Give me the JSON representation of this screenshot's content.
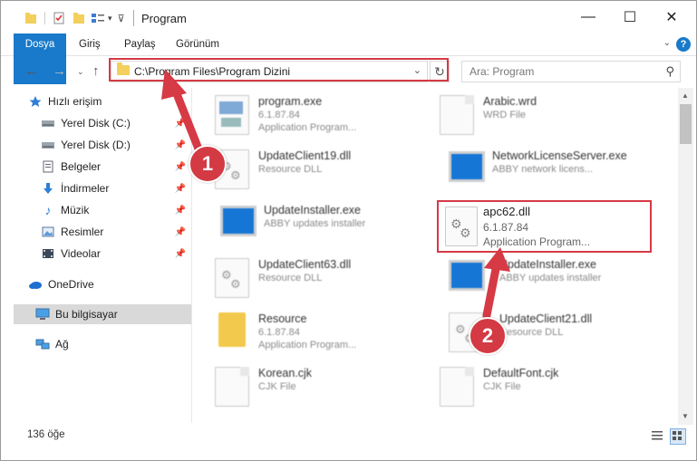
{
  "window": {
    "title": "Program",
    "minimize": "—",
    "maximize": "☐",
    "close": "✕"
  },
  "ribbon": {
    "tabs": [
      "Dosya",
      "Giriş",
      "Paylaş",
      "Görünüm"
    ],
    "help": "?"
  },
  "address": {
    "path": "C:\\Program Files\\Program Dizini"
  },
  "search": {
    "placeholder": "Ara: Program"
  },
  "sidebar": {
    "items": [
      {
        "label": "Hızlı erişim",
        "icon": "star-icon"
      },
      {
        "label": "Yerel Disk (C:)",
        "icon": "drive-icon",
        "pinned": true
      },
      {
        "label": "Yerel Disk (D:)",
        "icon": "drive-icon",
        "pinned": true
      },
      {
        "label": "Belgeler",
        "icon": "documents-icon",
        "pinned": true
      },
      {
        "label": "İndirmeler",
        "icon": "download-icon",
        "pinned": true
      },
      {
        "label": "Müzik",
        "icon": "music-icon",
        "pinned": true
      },
      {
        "label": "Resimler",
        "icon": "pictures-icon",
        "pinned": true
      },
      {
        "label": "Videolar",
        "icon": "videos-icon",
        "pinned": true
      },
      {
        "label": "OneDrive",
        "icon": "cloud-icon"
      },
      {
        "label": "Bu bilgisayar",
        "icon": "computer-icon",
        "selected": true
      },
      {
        "label": "Ağ",
        "icon": "network-icon"
      }
    ]
  },
  "files": [
    {
      "name": "program.exe",
      "line1": "6.1.87.84",
      "line2": "Application Program...",
      "kind": "exe"
    },
    {
      "name": "Arabic.wrd",
      "line1": "WRD File",
      "line2": "",
      "kind": "doc"
    },
    {
      "name": "UpdateClient19.dll",
      "line1": "Resource DLL",
      "line2": "",
      "kind": "dll"
    },
    {
      "name": "NetworkLicenseServer.exe",
      "line1": "ABBY network licens...",
      "line2": "",
      "kind": "win"
    },
    {
      "name": "UpdateInstaller.exe",
      "line1": "ABBY updates installer",
      "line2": "",
      "kind": "win"
    },
    {
      "name": "UpdateClient63.dll",
      "line1": "Resource DLL",
      "line2": "",
      "kind": "dll"
    },
    {
      "name": "UpdateInstaller.exe",
      "line1": "ABBY updates installer",
      "line2": "",
      "kind": "win"
    },
    {
      "name": "Resource",
      "line1": "6.1.87.84",
      "line2": "Application Program...",
      "kind": "folder"
    },
    {
      "name": "UpdateClient21.dll",
      "line1": "Resource DLL",
      "line2": "",
      "kind": "dll"
    },
    {
      "name": "Korean.cjk",
      "line1": "CJK File",
      "line2": "",
      "kind": "doc"
    },
    {
      "name": "DefaultFont.cjk",
      "line1": "CJK File",
      "line2": "",
      "kind": "doc"
    }
  ],
  "highlighted_file": {
    "name": "apc62.dll",
    "version": "6.1.87.84",
    "type": "Application Program..."
  },
  "status": {
    "count": "136 öğe"
  },
  "annotations": {
    "step1": "1",
    "step2": "2",
    "color": "#d63a45"
  }
}
